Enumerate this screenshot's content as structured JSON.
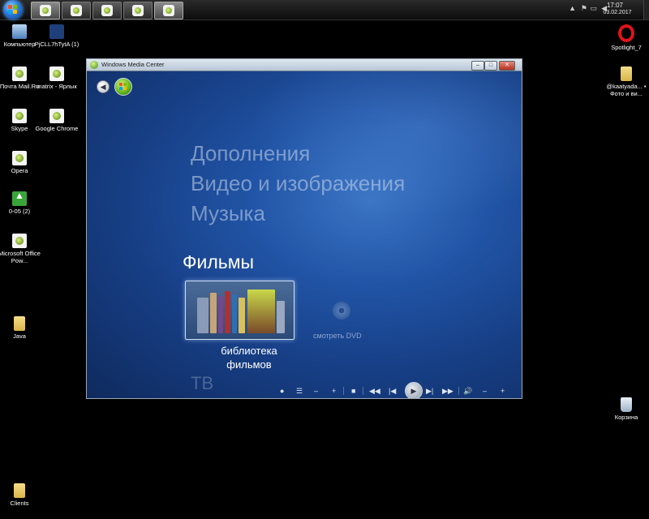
{
  "taskbar": {
    "clock_time": "17:07",
    "clock_date": "03.02.2017"
  },
  "desktop_icons": {
    "computer": "Компьютер",
    "pjcll": "PjCLL7hTytA (1)",
    "mailru": "Почта Mail.Ru",
    "matrix": "matrix - Ярлык",
    "skype": "Skype",
    "chrome": "Google Chrome",
    "opera_file": "Opera",
    "o05": "0-05 (2)",
    "office": "Microsoft Office Pow...",
    "java": "Java",
    "clients": "Clients",
    "spotlight": "Spotlight_7",
    "kaatyada": "@kaatyada... • Фото и ви...",
    "recycle": "Корзина"
  },
  "wmc": {
    "title": "Windows Media Center",
    "menu": {
      "item1": "Дополнения",
      "item2": "Видео и изображения",
      "item3": "Музыка",
      "active": "Фильмы",
      "next": "ТВ"
    },
    "tiles": {
      "library_label": "библиотека фильмов",
      "dvd_label": "смотреть DVD"
    }
  },
  "colors": {
    "wmc_background": "#173f86",
    "taskbar": "#1a1a1a",
    "opera_red": "#e0131c"
  }
}
